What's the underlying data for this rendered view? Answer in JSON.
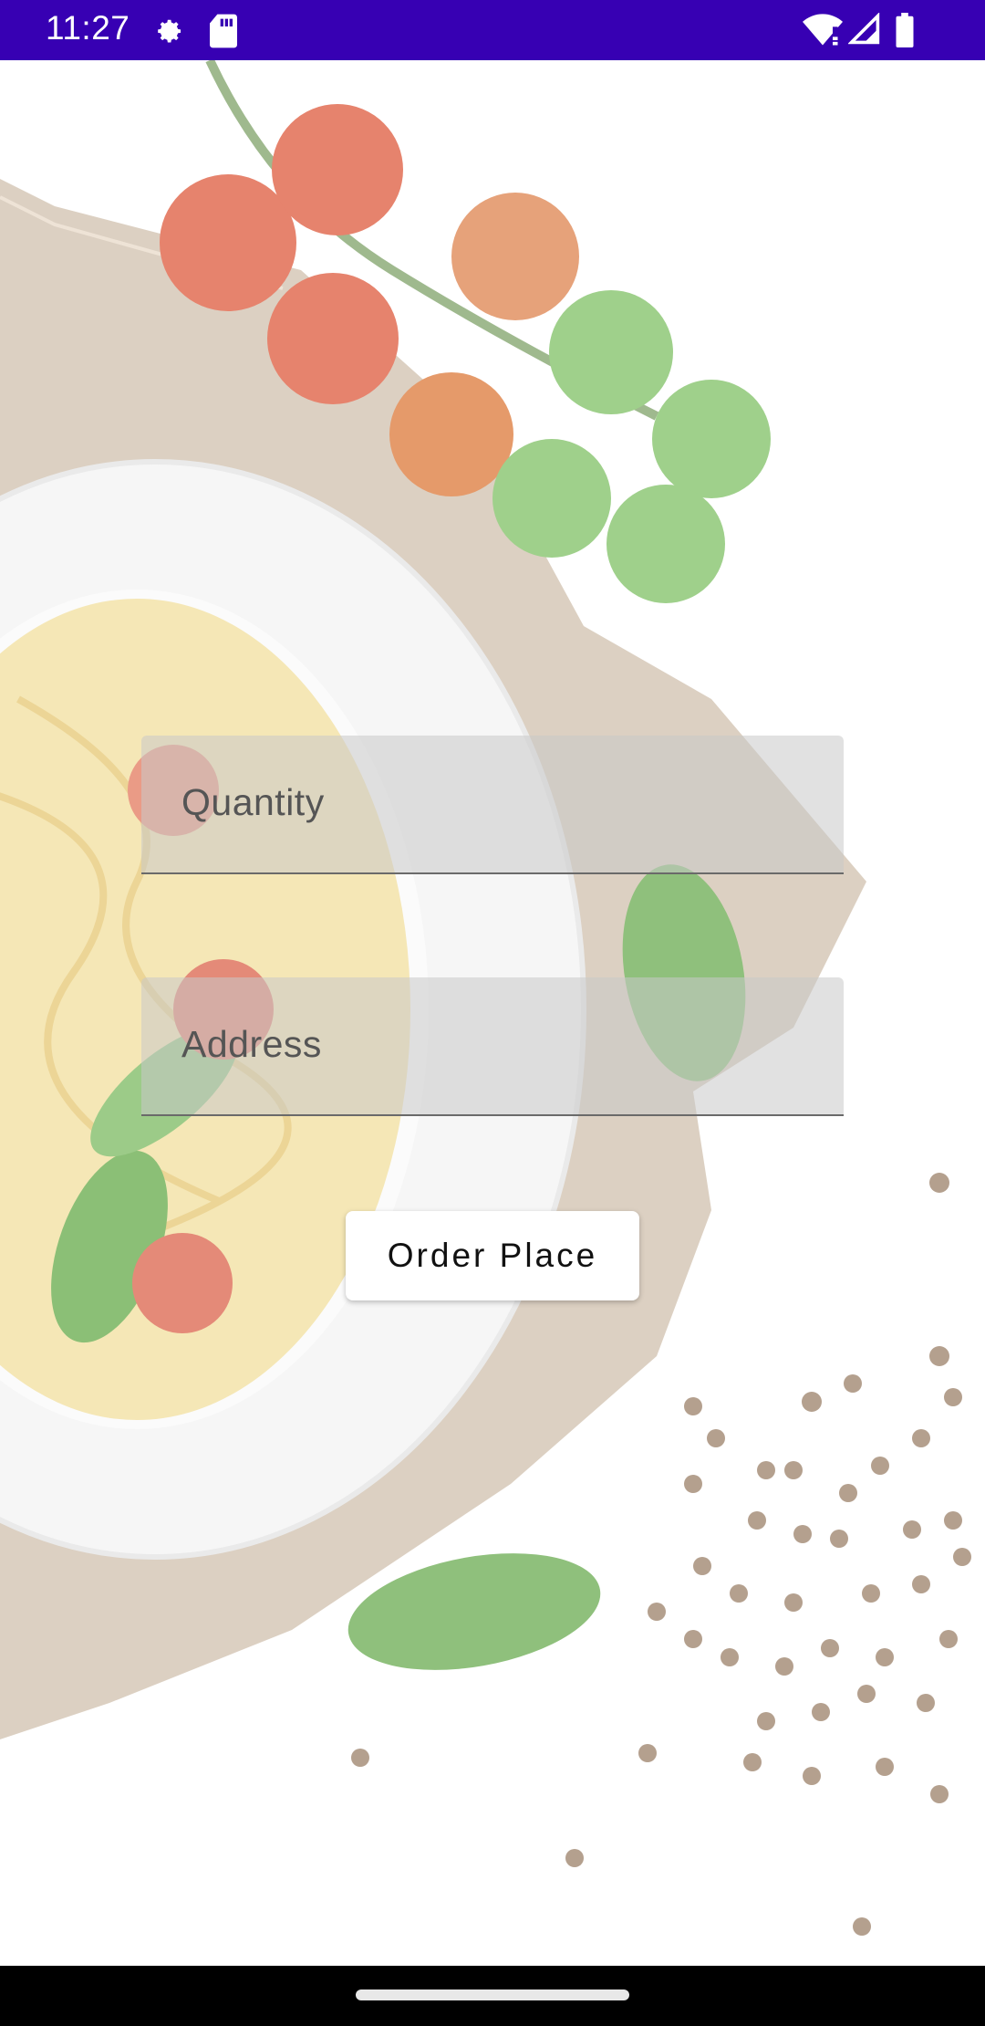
{
  "status_bar": {
    "time": "11:27",
    "icons_left": [
      "settings-gear-icon",
      "sd-card-icon"
    ],
    "icons_right": [
      "wifi-alert-icon",
      "cell-signal-icon",
      "battery-icon"
    ],
    "color": "#3700b3"
  },
  "background": {
    "description_icons": [
      "pasta-plate",
      "burlap-cloth",
      "cherry-tomatoes",
      "basil-leaf",
      "peppercorns"
    ]
  },
  "form": {
    "quantity_placeholder": "Quantity",
    "address_placeholder": "Address",
    "submit_label": "Order Place"
  },
  "nav_bar": {
    "color": "#000000"
  }
}
